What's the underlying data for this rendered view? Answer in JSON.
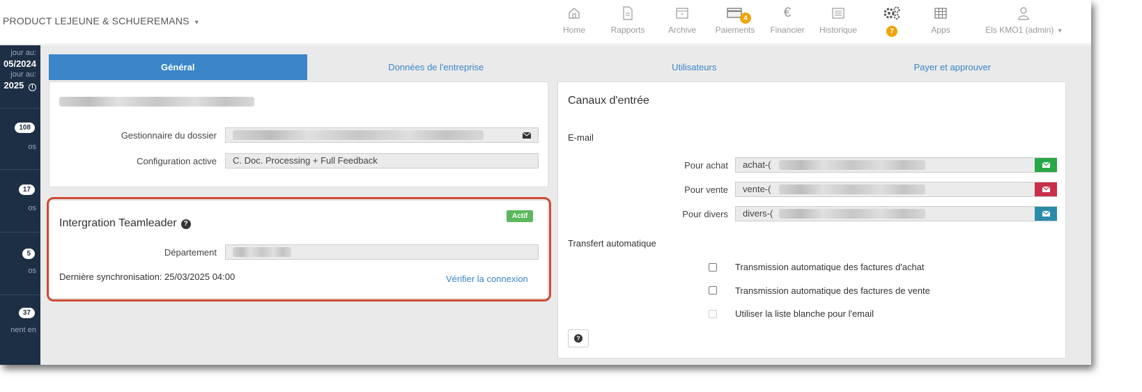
{
  "header": {
    "company": "PRODUCT LEJEUNE & SCHUEREMANS",
    "company_caret": "▾",
    "nav": [
      {
        "label": "Home",
        "icon": "home-icon"
      },
      {
        "label": "Rapports",
        "icon": "report-icon"
      },
      {
        "label": "Archive",
        "icon": "archive-icon"
      },
      {
        "label": "Paiements",
        "icon": "payments-icon",
        "badge": "4"
      },
      {
        "label": "Financier",
        "icon": "euro-icon"
      },
      {
        "label": "Historique",
        "icon": "history-icon"
      },
      {
        "label": "",
        "icon": "gears-icon",
        "badge": "7"
      },
      {
        "label": "Apps",
        "icon": "apps-grid-icon"
      }
    ],
    "user": "Els KMO1 (admin)",
    "user_caret": "▾"
  },
  "sidebar": {
    "line1": "jour au:",
    "line2": "05/2024",
    "line3": "jour au:",
    "line4": "2025",
    "counters": [
      {
        "value": "108",
        "sub": "os"
      },
      {
        "value": "17",
        "sub": "os"
      },
      {
        "value": "5",
        "sub": "os"
      },
      {
        "value": "37",
        "sub": "nent en"
      }
    ]
  },
  "tabs": [
    {
      "label": "Général",
      "active": true
    },
    {
      "label": "Données de l'entreprise",
      "active": false
    },
    {
      "label": "Utilisateurs",
      "active": false
    },
    {
      "label": "Payer et approuver",
      "active": false
    }
  ],
  "general": {
    "manager_label": "Gestionnaire du dossier",
    "config_label": "Configuration active",
    "config_value": "C. Doc. Processing + Full Feedback"
  },
  "teamleader": {
    "title": "Intergration Teamleader",
    "status": "Actif",
    "department_label": "Département",
    "last_sync": "Dernière synchronisation: 25/03/2025 04:00",
    "verify_link": "Vérifier la connexion"
  },
  "channels": {
    "title": "Canaux d'entrée",
    "email_heading": "E-mail",
    "rows": [
      {
        "label": "Pour achat",
        "value": "achat-(",
        "color": "#28a745"
      },
      {
        "label": "Pour vente",
        "value": "vente-(",
        "color": "#c8304a"
      },
      {
        "label": "Pour divers",
        "value": "divers-(",
        "color": "#2a8ca8"
      }
    ],
    "transfer_heading": "Transfert automatique",
    "options": [
      "Transmission automatique des factures d'achat",
      "Transmission automatique des factures de vente",
      "Utiliser la liste blanche pour l'email"
    ]
  },
  "colors": {
    "accent": "#3a86c8",
    "sidebar": "#1d2f45",
    "highlight": "#cf4a36",
    "badge": "#f0a30a",
    "active_badge": "#5cb85c"
  }
}
